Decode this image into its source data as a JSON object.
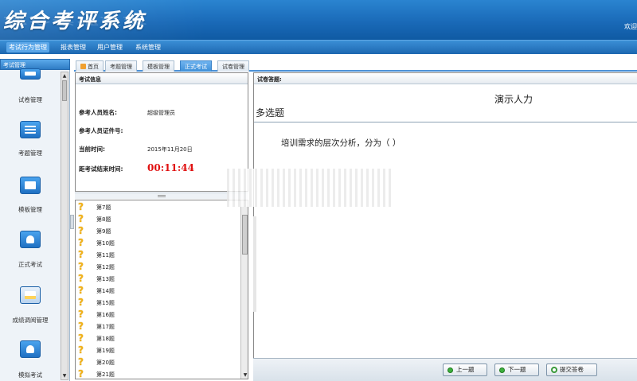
{
  "header": {
    "app_title": "综合考评系统",
    "welcome_text": "欢迎"
  },
  "menu": [
    {
      "label": "考试行为管理",
      "active": true
    },
    {
      "label": "报表管理",
      "active": false
    },
    {
      "label": "用户管理",
      "active": false
    },
    {
      "label": "系统管理",
      "active": false
    }
  ],
  "sidebar": {
    "title": "考试管理",
    "items": [
      {
        "label": "试卷管理",
        "icon": "document-icon"
      },
      {
        "label": "考题管理",
        "icon": "list-icon"
      },
      {
        "label": "模板管理",
        "icon": "template-icon"
      },
      {
        "label": "正式考试",
        "icon": "exam-person-icon"
      },
      {
        "label": "成绩调阅管理",
        "icon": "calendar-icon"
      },
      {
        "label": "模拟考试",
        "icon": "mock-exam-icon"
      }
    ]
  },
  "tabs": [
    {
      "label": "首页",
      "active": false
    },
    {
      "label": "考题管理",
      "active": false
    },
    {
      "label": "模板管理",
      "active": false
    },
    {
      "label": "正式考试",
      "active": true
    },
    {
      "label": "试卷管理",
      "active": false
    }
  ],
  "exam_info": {
    "title": "考试信息",
    "name_label": "参考人员姓名:",
    "name_value": "超级管理员",
    "id_label": "参考人员证件号:",
    "id_value": "",
    "time_label": "当前时间:",
    "time_value": "2015年11月20日",
    "countdown_label": "距考试结束时间:",
    "countdown_value": "00:11:44"
  },
  "question_list": [
    "第7题",
    "第8题",
    "第9题",
    "第10题",
    "第11题",
    "第12题",
    "第13题",
    "第14题",
    "第15题",
    "第16题",
    "第17题",
    "第18题",
    "第19题",
    "第20题",
    "第21题"
  ],
  "paper": {
    "title": "试卷答题:",
    "paper_name": "演示人力",
    "question_type": "多选题",
    "question_text": "培训需求的层次分析，分为（   ）"
  },
  "buttons": {
    "prev": "上一题",
    "next": "下一题",
    "submit": "提交答卷"
  },
  "colors": {
    "header": "#1a6ab8",
    "active_tab": "#3d8fd8",
    "countdown": "#e01010",
    "question_mark": "#f1b31c"
  }
}
